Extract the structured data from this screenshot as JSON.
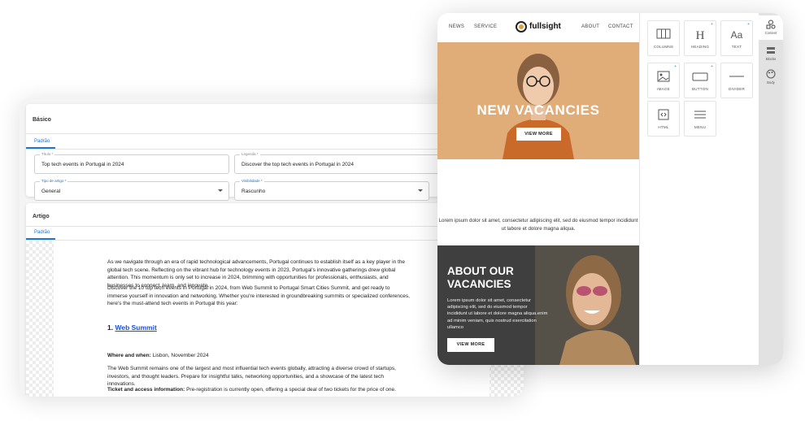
{
  "cms": {
    "basico": {
      "title": "Básico",
      "tab": "Padrão",
      "fields": {
        "titulo": {
          "label": "Título *",
          "value": "Top tech events in Portugal in 2024"
        },
        "legenda": {
          "label": "Legenda *",
          "value": "Discover the top tech events in Portugal in 2024"
        },
        "tipo": {
          "label": "Tipo de artigo *",
          "value": "General"
        },
        "visibilidade": {
          "label": "Visibilidade *",
          "value": "Rascunho"
        }
      }
    },
    "artigo": {
      "title": "Artigo",
      "tab": "Padrão",
      "paragraph1": "As we navigate through an era of rapid technological advancements, Portugal continues to establish itself as a key player in the global tech scene. Reflecting on the vibrant hub for technology events in 2023, Portugal's innovative gatherings drew global attention. This momentum is only set to increase in 2024, brimming with opportunities for professionals, enthusiasts, and businesses to connect, learn, and innovate.",
      "paragraph2": "Discover the 10 top tech events in Portugal in 2024, from Web Summit to Portugal Smart Cities Summit, and get ready to immerse yourself in innovation and networking. Whether you're interested in groundbreaking summits or specialized conferences, here's the must-attend tech events in Portugal this year:",
      "heading_number": "1.",
      "heading_link": "Web Summit",
      "where_label": "Where and when:",
      "where_value": "Lisbon, November 2024",
      "paragraph3": "The Web Summit remains one of the largest and most influential tech events globally, attracting a diverse crowd of startups, investors, and thought leaders. Prepare for insightful talks, networking opportunities, and a showcase of the latest tech innovations.",
      "ticket_label": "Ticket and access information:",
      "ticket_value": "Pre-registration is currently open, offering a special deal of two tickets for the price of one."
    }
  },
  "email": {
    "nav": {
      "news": "NEWS",
      "service": "SERVICE",
      "brand": "fullsight",
      "about": "ABOUT",
      "contact": "CONTACT"
    },
    "hero": {
      "title": "NEW VACANCIES",
      "button": "VIEW MORE"
    },
    "lorem": "Lorem ipsum dolor sit amet, consectetur adipiscing elit, sed do eiusmod tempor incididunt ut labore et dolore magna aliqua.",
    "about": {
      "title": "ABOUT OUR VACANCIES",
      "body": "Lorem ipsum dolor sit amet, consectetur adipiscing elit, sed do eiusmod tempor incididunt ut labore et dolore magna aliqua.enim ad minim veniam, quis nostrud exercitation ullamco",
      "button": "VIEW MORE"
    }
  },
  "blocks": [
    {
      "label": "COLUMNS",
      "icon": "columns-icon"
    },
    {
      "label": "HEADING",
      "icon": "heading-icon"
    },
    {
      "label": "TEXT",
      "icon": "text-icon"
    },
    {
      "label": "IMAGE",
      "icon": "image-icon"
    },
    {
      "label": "BUTTON",
      "icon": "button-icon"
    },
    {
      "label": "DIVIDER",
      "icon": "divider-icon"
    },
    {
      "label": "HTML",
      "icon": "code-icon"
    },
    {
      "label": "MENU",
      "icon": "menu-icon"
    }
  ],
  "sidebar": [
    {
      "label": "Content",
      "icon": "shapes-icon"
    },
    {
      "label": "Blocks",
      "icon": "blocks-icon"
    },
    {
      "label": "Body",
      "icon": "palette-icon"
    }
  ],
  "colors": {
    "accent": "#1976d2",
    "hero_bg": "#e0ac78",
    "dark_bg": "#3f3f3f",
    "teal": "#2aa7a0"
  }
}
